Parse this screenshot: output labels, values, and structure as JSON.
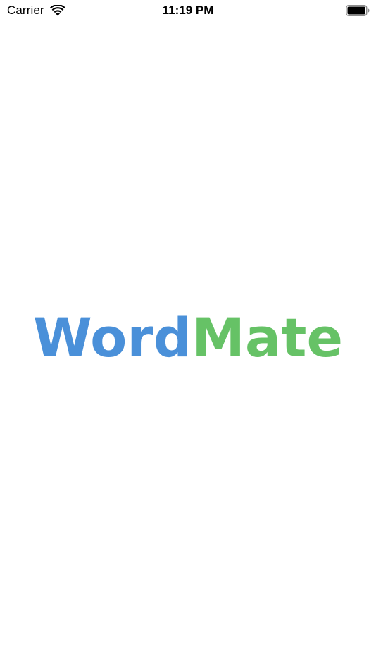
{
  "status_bar": {
    "carrier": "Carrier",
    "time": "11:19 PM",
    "icons": {
      "wifi": "wifi-icon",
      "battery": "battery-full-icon"
    }
  },
  "splash": {
    "logo_part1": "Word",
    "logo_part2": "Mate",
    "colors": {
      "part1": "#4A90D9",
      "part2": "#66C266",
      "background": "#FFFFFF"
    }
  }
}
